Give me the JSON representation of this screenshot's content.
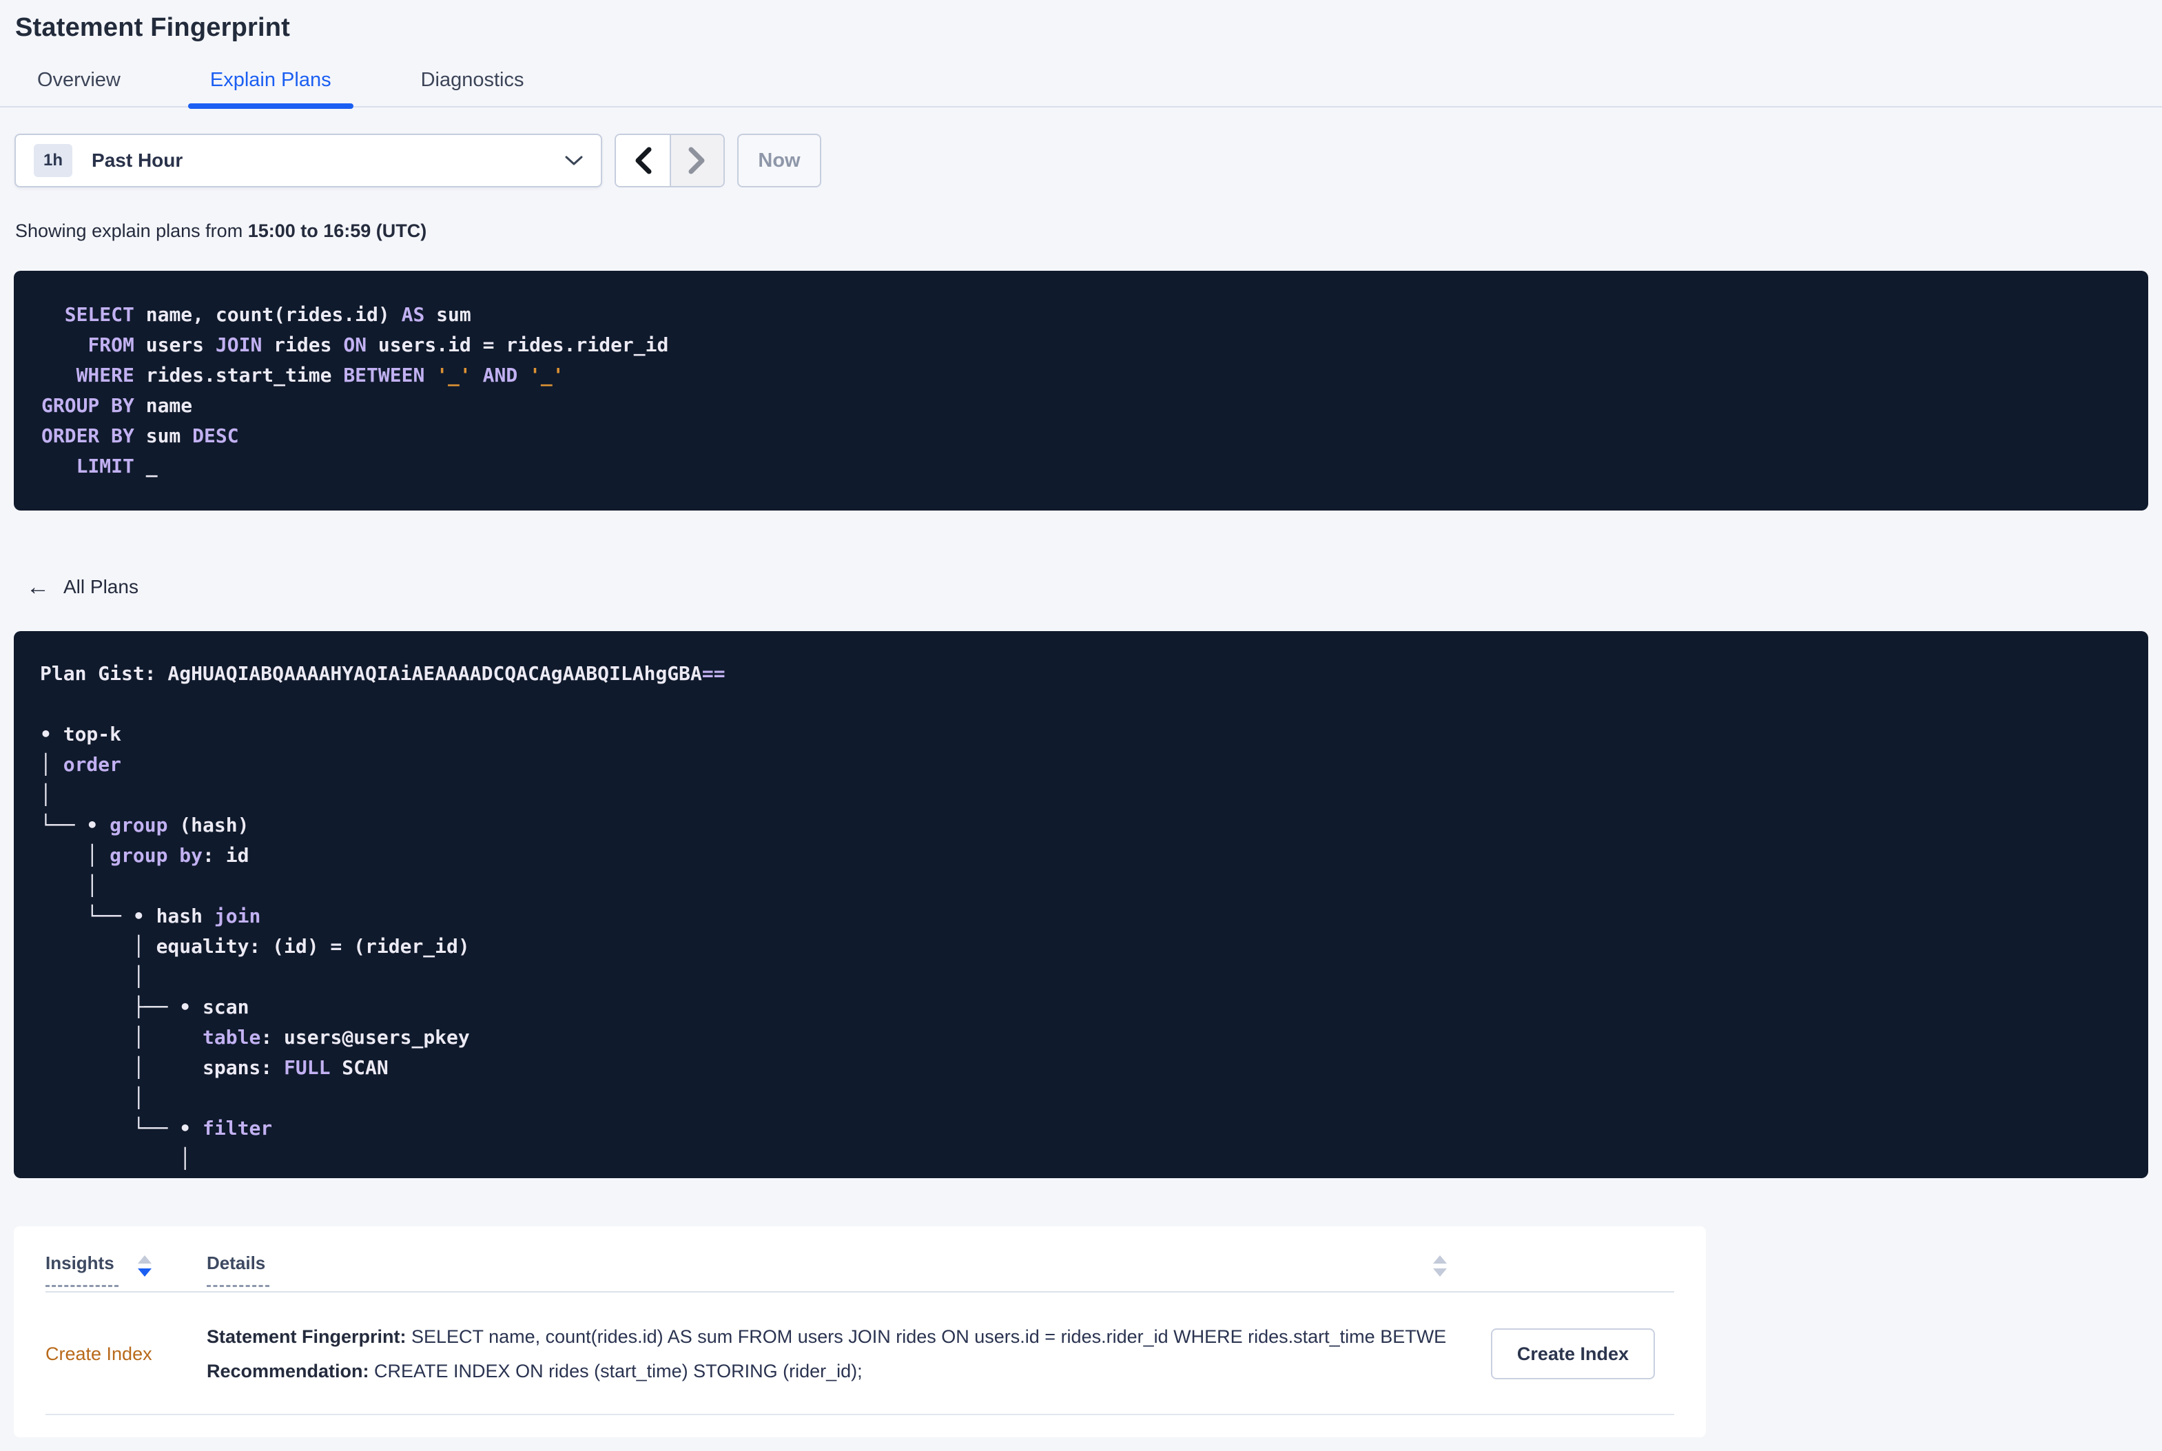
{
  "page": {
    "title": "Statement Fingerprint"
  },
  "tabs": [
    {
      "label": "Overview",
      "active": false
    },
    {
      "label": "Explain Plans",
      "active": true
    },
    {
      "label": "Diagnostics",
      "active": false
    }
  ],
  "time_selector": {
    "badge": "1h",
    "label": "Past Hour",
    "now_label": "Now"
  },
  "subtitle": {
    "prefix": "Showing explain plans from ",
    "range": "15:00 to 16:59 (UTC)"
  },
  "colors": {
    "accent_blue": "#1b5ff2",
    "link_orange": "#b8691a",
    "code_background": "#0f1a2c",
    "code_keyword": "#c2b1f2",
    "code_placeholder": "#dd9234",
    "code_text": "#eceaf4"
  },
  "sql": {
    "lines": [
      [
        {
          "t": "  "
        },
        {
          "t": "SELECT",
          "c": "k"
        },
        {
          "t": " name, count(rides.id) "
        },
        {
          "t": "AS",
          "c": "k"
        },
        {
          "t": " sum"
        }
      ],
      [
        {
          "t": "    "
        },
        {
          "t": "FROM",
          "c": "k"
        },
        {
          "t": " users "
        },
        {
          "t": "JOIN",
          "c": "k"
        },
        {
          "t": " rides "
        },
        {
          "t": "ON",
          "c": "k"
        },
        {
          "t": " users.id = rides.rider_id"
        }
      ],
      [
        {
          "t": "   "
        },
        {
          "t": "WHERE",
          "c": "k"
        },
        {
          "t": " rides.start_time "
        },
        {
          "t": "BETWEEN",
          "c": "k"
        },
        {
          "t": " "
        },
        {
          "t": "'_'",
          "c": "p"
        },
        {
          "t": " "
        },
        {
          "t": "AND",
          "c": "k"
        },
        {
          "t": " "
        },
        {
          "t": "'_'",
          "c": "p"
        }
      ],
      [
        {
          "t": "GROUP BY",
          "c": "k"
        },
        {
          "t": " name"
        }
      ],
      [
        {
          "t": "ORDER BY",
          "c": "k"
        },
        {
          "t": " sum "
        },
        {
          "t": "DESC",
          "c": "k"
        }
      ],
      [
        {
          "t": "   "
        },
        {
          "t": "LIMIT",
          "c": "k"
        },
        {
          "t": " _"
        }
      ]
    ]
  },
  "back_link": {
    "arrow": "←",
    "label": "All Plans"
  },
  "plan": {
    "gist": "AgHUAQIABQAAAAHYAQIAiAEAAAADCQACAgAABQILAhgGBA==",
    "lines": [
      [
        {
          "t": "Plan Gist: AgHUAQIABQAAAAHYAQIAiAEAAAADCQACAgAABQILAhgGBA"
        },
        {
          "t": "==",
          "c": "k"
        }
      ],
      [],
      [
        {
          "t": "• top-k"
        }
      ],
      [
        {
          "t": "│ "
        },
        {
          "t": "order",
          "c": "k"
        }
      ],
      [
        {
          "t": "│"
        }
      ],
      [
        {
          "t": "└── • "
        },
        {
          "t": "group",
          "c": "k"
        },
        {
          "t": " (hash)"
        }
      ],
      [
        {
          "t": "    │ "
        },
        {
          "t": "group by",
          "c": "k"
        },
        {
          "t": ": id"
        }
      ],
      [
        {
          "t": "    │"
        }
      ],
      [
        {
          "t": "    └── • hash "
        },
        {
          "t": "join",
          "c": "k"
        }
      ],
      [
        {
          "t": "        │ equality: (id) = (rider_id)"
        }
      ],
      [
        {
          "t": "        │"
        }
      ],
      [
        {
          "t": "        ├── • scan"
        }
      ],
      [
        {
          "t": "        │     "
        },
        {
          "t": "table",
          "c": "k"
        },
        {
          "t": ": users@users_pkey"
        }
      ],
      [
        {
          "t": "        │     spans: "
        },
        {
          "t": "FULL",
          "c": "k"
        },
        {
          "t": " SCAN"
        }
      ],
      [
        {
          "t": "        │"
        }
      ],
      [
        {
          "t": "        └── • "
        },
        {
          "t": "filter",
          "c": "k"
        }
      ],
      [
        {
          "t": "            │"
        }
      ]
    ]
  },
  "insights_table": {
    "columns": [
      {
        "label": "Insights",
        "sort": "desc"
      },
      {
        "label": "Details",
        "sort": "none"
      }
    ],
    "rows": [
      {
        "insight": "Create Index",
        "fingerprint_label": "Statement Fingerprint:",
        "fingerprint": " SELECT name, count(rides.id) AS sum FROM users JOIN rides ON users.id = rides.rider_id WHERE rides.start_time BETWEEN '_…",
        "recommendation_label": "Recommendation:",
        "recommendation": " CREATE INDEX ON rides (start_time) STORING (rider_id);",
        "action_label": "Create Index"
      }
    ]
  }
}
